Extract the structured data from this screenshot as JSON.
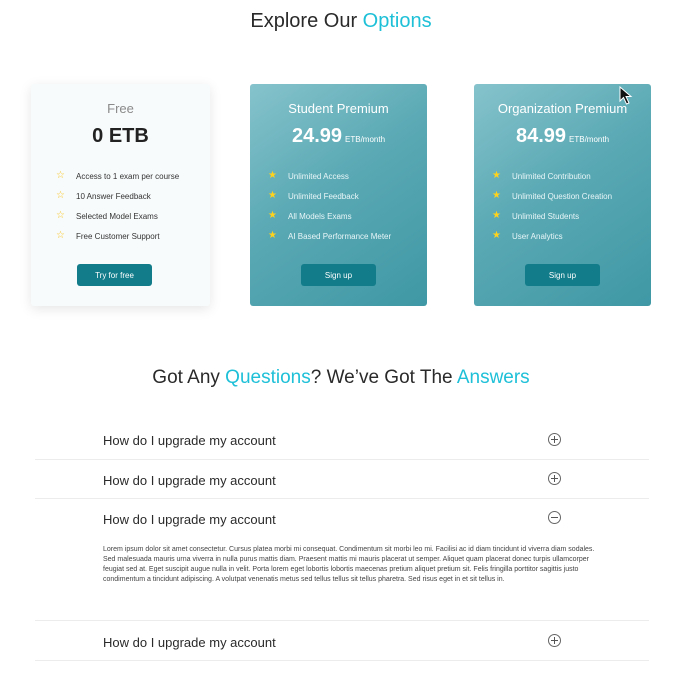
{
  "explore": {
    "title_prefix": "Explore Our ",
    "title_accent": "Options"
  },
  "plans": [
    {
      "name": "Free",
      "price": "0 ETB",
      "unit": "",
      "features": [
        "Access to 1 exam per course",
        "10 Answer Feedback",
        "Selected Model Exams",
        "Free Customer Support"
      ],
      "button": "Try for free"
    },
    {
      "name": "Student Premium",
      "price": "24.99",
      "unit": "ETB/month",
      "features": [
        "Unlimited Access",
        "Unlimited Feedback",
        "All Models Exams",
        "AI Based Performance Meter"
      ],
      "button": "Sign up"
    },
    {
      "name": "Organization Premium",
      "price": "84.99",
      "unit": "ETB/month",
      "features": [
        "Unlimited Contribution",
        "Unlimited Question Creation",
        "Unlimited Students",
        "User Analytics"
      ],
      "button": "Sign up"
    }
  ],
  "faq": {
    "title_part1": "Got Any ",
    "title_accent1": "Questions",
    "title_part2": "? We’ve Got The ",
    "title_accent2": "Answers",
    "items": [
      {
        "question": "How do I upgrade my account",
        "expanded": false,
        "answer": ""
      },
      {
        "question": "How do I upgrade my account",
        "expanded": false,
        "answer": ""
      },
      {
        "question": "How do I upgrade my account",
        "expanded": true,
        "answer": "Lorem ipsum dolor sit amet consectetur. Cursus platea morbi mi consequat. Condimentum sit morbi leo mi. Facilisi ac id diam tincidunt id viverra diam sodales. Sed malesuada mauris urna viverra in nulla purus mattis diam. Praesent mattis mi mauris placerat ut semper. Aliquet quam placerat donec turpis ullamcorper feugiat sed at. Eget suscipit augue nulla in velit. Porta lorem eget lobortis lobortis maecenas pretium aliquet pretium sit. Felis fringilla porttitor sagittis justo condimentum a tincidunt adipiscing. A volutpat venenatis metus sed tellus tellus sit tellus pharetra. Sed risus eget in et sit tellus in."
      },
      {
        "question": "How do I upgrade my account",
        "expanded": false,
        "answer": ""
      }
    ]
  },
  "icons": {
    "feature": "star-icon",
    "collapsed": "plus-circle-icon",
    "expanded": "minus-circle-icon",
    "pointer": "mouse-cursor-icon"
  },
  "colors": {
    "accent": "#1ec0d8",
    "button": "#127c8a",
    "card_teal": "#5aa9b4",
    "star": "#ffd21c"
  }
}
